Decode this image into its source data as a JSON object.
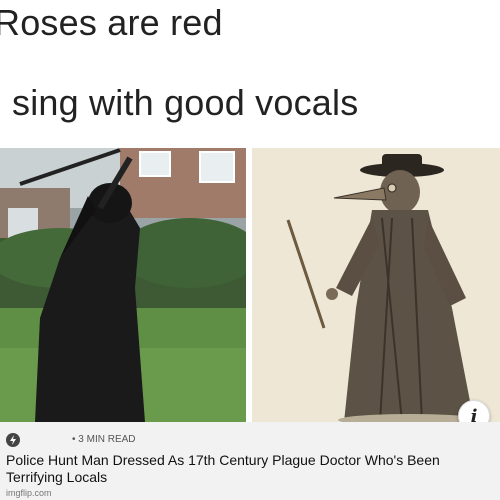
{
  "caption": {
    "line1": "Roses are red",
    "line2": "sing with good vocals"
  },
  "article": {
    "read_time": "• 3 MIN READ",
    "headline": "Police Hunt Man Dressed As 17th Century Plague Doctor Who's Been Terrifying Locals",
    "source_icon": "lightning-icon",
    "info_icon": "info-icon",
    "info_label": "i"
  },
  "watermark": "imgflip.com"
}
